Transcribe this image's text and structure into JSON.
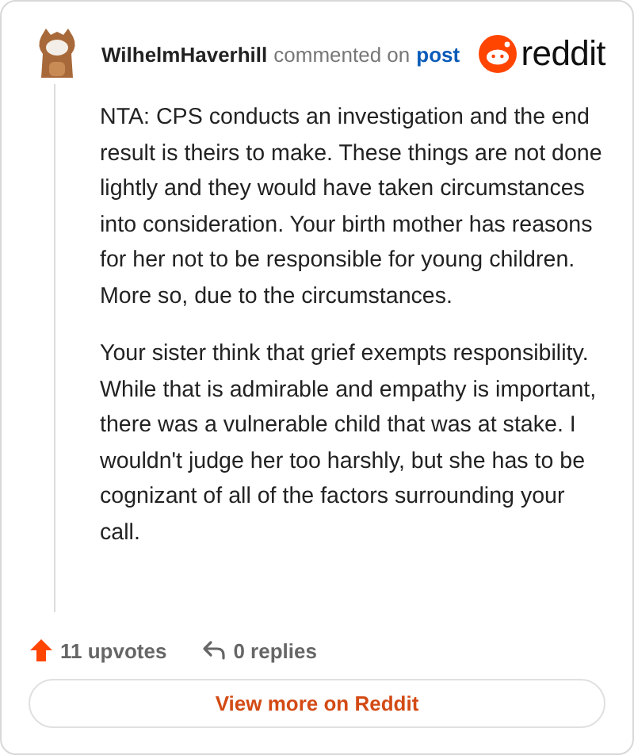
{
  "comment": {
    "author": "WilhelmHaverhill",
    "action": "commented on",
    "link": "post"
  },
  "brand": {
    "name": "reddit"
  },
  "body": [
    "NTA: CPS conducts an investigation and the end result is theirs to make. These things are not done lightly and they would have taken circumstances into consideration. Your birth mother has reasons for her not to be responsible for young children. More so, due to the circumstances.",
    "Your sister think that grief exempts responsibility. While that is admirable and empathy is important, there was a vulnerable child that was at stake. I wouldn't judge her too harshly, but she has to be cognizant of all of the factors surrounding your call."
  ],
  "stats": {
    "upvotes": "11 upvotes",
    "replies": "0 replies"
  },
  "button": "View more on Reddit"
}
